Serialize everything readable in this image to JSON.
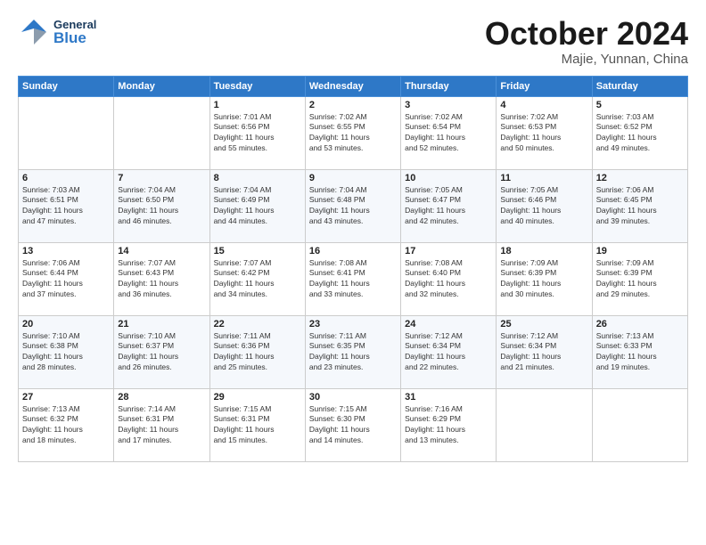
{
  "header": {
    "logo_general": "General",
    "logo_blue": "Blue",
    "month": "October 2024",
    "location": "Majie, Yunnan, China"
  },
  "days_of_week": [
    "Sunday",
    "Monday",
    "Tuesday",
    "Wednesday",
    "Thursday",
    "Friday",
    "Saturday"
  ],
  "weeks": [
    [
      {
        "day": "",
        "info": ""
      },
      {
        "day": "",
        "info": ""
      },
      {
        "day": "1",
        "info": "Sunrise: 7:01 AM\nSunset: 6:56 PM\nDaylight: 11 hours\nand 55 minutes."
      },
      {
        "day": "2",
        "info": "Sunrise: 7:02 AM\nSunset: 6:55 PM\nDaylight: 11 hours\nand 53 minutes."
      },
      {
        "day": "3",
        "info": "Sunrise: 7:02 AM\nSunset: 6:54 PM\nDaylight: 11 hours\nand 52 minutes."
      },
      {
        "day": "4",
        "info": "Sunrise: 7:02 AM\nSunset: 6:53 PM\nDaylight: 11 hours\nand 50 minutes."
      },
      {
        "day": "5",
        "info": "Sunrise: 7:03 AM\nSunset: 6:52 PM\nDaylight: 11 hours\nand 49 minutes."
      }
    ],
    [
      {
        "day": "6",
        "info": "Sunrise: 7:03 AM\nSunset: 6:51 PM\nDaylight: 11 hours\nand 47 minutes."
      },
      {
        "day": "7",
        "info": "Sunrise: 7:04 AM\nSunset: 6:50 PM\nDaylight: 11 hours\nand 46 minutes."
      },
      {
        "day": "8",
        "info": "Sunrise: 7:04 AM\nSunset: 6:49 PM\nDaylight: 11 hours\nand 44 minutes."
      },
      {
        "day": "9",
        "info": "Sunrise: 7:04 AM\nSunset: 6:48 PM\nDaylight: 11 hours\nand 43 minutes."
      },
      {
        "day": "10",
        "info": "Sunrise: 7:05 AM\nSunset: 6:47 PM\nDaylight: 11 hours\nand 42 minutes."
      },
      {
        "day": "11",
        "info": "Sunrise: 7:05 AM\nSunset: 6:46 PM\nDaylight: 11 hours\nand 40 minutes."
      },
      {
        "day": "12",
        "info": "Sunrise: 7:06 AM\nSunset: 6:45 PM\nDaylight: 11 hours\nand 39 minutes."
      }
    ],
    [
      {
        "day": "13",
        "info": "Sunrise: 7:06 AM\nSunset: 6:44 PM\nDaylight: 11 hours\nand 37 minutes."
      },
      {
        "day": "14",
        "info": "Sunrise: 7:07 AM\nSunset: 6:43 PM\nDaylight: 11 hours\nand 36 minutes."
      },
      {
        "day": "15",
        "info": "Sunrise: 7:07 AM\nSunset: 6:42 PM\nDaylight: 11 hours\nand 34 minutes."
      },
      {
        "day": "16",
        "info": "Sunrise: 7:08 AM\nSunset: 6:41 PM\nDaylight: 11 hours\nand 33 minutes."
      },
      {
        "day": "17",
        "info": "Sunrise: 7:08 AM\nSunset: 6:40 PM\nDaylight: 11 hours\nand 32 minutes."
      },
      {
        "day": "18",
        "info": "Sunrise: 7:09 AM\nSunset: 6:39 PM\nDaylight: 11 hours\nand 30 minutes."
      },
      {
        "day": "19",
        "info": "Sunrise: 7:09 AM\nSunset: 6:39 PM\nDaylight: 11 hours\nand 29 minutes."
      }
    ],
    [
      {
        "day": "20",
        "info": "Sunrise: 7:10 AM\nSunset: 6:38 PM\nDaylight: 11 hours\nand 28 minutes."
      },
      {
        "day": "21",
        "info": "Sunrise: 7:10 AM\nSunset: 6:37 PM\nDaylight: 11 hours\nand 26 minutes."
      },
      {
        "day": "22",
        "info": "Sunrise: 7:11 AM\nSunset: 6:36 PM\nDaylight: 11 hours\nand 25 minutes."
      },
      {
        "day": "23",
        "info": "Sunrise: 7:11 AM\nSunset: 6:35 PM\nDaylight: 11 hours\nand 23 minutes."
      },
      {
        "day": "24",
        "info": "Sunrise: 7:12 AM\nSunset: 6:34 PM\nDaylight: 11 hours\nand 22 minutes."
      },
      {
        "day": "25",
        "info": "Sunrise: 7:12 AM\nSunset: 6:34 PM\nDaylight: 11 hours\nand 21 minutes."
      },
      {
        "day": "26",
        "info": "Sunrise: 7:13 AM\nSunset: 6:33 PM\nDaylight: 11 hours\nand 19 minutes."
      }
    ],
    [
      {
        "day": "27",
        "info": "Sunrise: 7:13 AM\nSunset: 6:32 PM\nDaylight: 11 hours\nand 18 minutes."
      },
      {
        "day": "28",
        "info": "Sunrise: 7:14 AM\nSunset: 6:31 PM\nDaylight: 11 hours\nand 17 minutes."
      },
      {
        "day": "29",
        "info": "Sunrise: 7:15 AM\nSunset: 6:31 PM\nDaylight: 11 hours\nand 15 minutes."
      },
      {
        "day": "30",
        "info": "Sunrise: 7:15 AM\nSunset: 6:30 PM\nDaylight: 11 hours\nand 14 minutes."
      },
      {
        "day": "31",
        "info": "Sunrise: 7:16 AM\nSunset: 6:29 PM\nDaylight: 11 hours\nand 13 minutes."
      },
      {
        "day": "",
        "info": ""
      },
      {
        "day": "",
        "info": ""
      }
    ]
  ]
}
